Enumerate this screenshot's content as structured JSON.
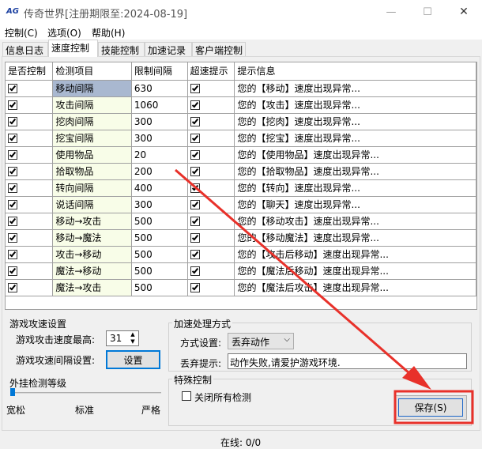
{
  "titlebar": {
    "logo": "AG",
    "title": "传奇世界[注册期限至:2024-08-19]"
  },
  "menubar": {
    "items": [
      "控制(C)",
      "选项(O)",
      "帮助(H)"
    ]
  },
  "tabs": [
    "信息日志",
    "速度控制",
    "技能控制",
    "加速记录",
    "客户端控制"
  ],
  "active_tab": 1,
  "grid": {
    "headers": [
      "是否控制",
      "检测项目",
      "限制间隔",
      "超速提示",
      "提示信息"
    ],
    "rows": [
      {
        "checked": true,
        "item": "移动间隔",
        "interval": "630",
        "warn": true,
        "msg": "您的【移动】速度出现异常..."
      },
      {
        "checked": true,
        "item": "攻击间隔",
        "interval": "1060",
        "warn": true,
        "msg": "您的【攻击】速度出现异常..."
      },
      {
        "checked": true,
        "item": "挖肉间隔",
        "interval": "300",
        "warn": true,
        "msg": "您的【挖肉】速度出现异常..."
      },
      {
        "checked": true,
        "item": "挖宝间隔",
        "interval": "300",
        "warn": true,
        "msg": "您的【挖宝】速度出现异常..."
      },
      {
        "checked": true,
        "item": "使用物品",
        "interval": "20",
        "warn": true,
        "msg": "您的【使用物品】速度出现异常..."
      },
      {
        "checked": true,
        "item": "拾取物品",
        "interval": "200",
        "warn": true,
        "msg": "您的【拾取物品】速度出现异常..."
      },
      {
        "checked": true,
        "item": "转向间隔",
        "interval": "400",
        "warn": true,
        "msg": "您的【转向】速度出现异常..."
      },
      {
        "checked": true,
        "item": "说话间隔",
        "interval": "300",
        "warn": true,
        "msg": "您的【聊天】速度出现异常..."
      },
      {
        "checked": true,
        "item": "移动→攻击",
        "interval": "500",
        "warn": true,
        "msg": "您的【移动攻击】速度出现异常..."
      },
      {
        "checked": true,
        "item": "移动→魔法",
        "interval": "500",
        "warn": true,
        "msg": "您的【移动魔法】速度出现异常..."
      },
      {
        "checked": true,
        "item": "攻击→移动",
        "interval": "500",
        "warn": true,
        "msg": "您的【攻击后移动】速度出现异常..."
      },
      {
        "checked": true,
        "item": "魔法→移动",
        "interval": "500",
        "warn": true,
        "msg": "您的【魔法后移动】速度出现异常..."
      },
      {
        "checked": true,
        "item": "魔法→攻击",
        "interval": "500",
        "warn": true,
        "msg": "您的【魔法后攻击】速度出现异常..."
      }
    ]
  },
  "attack_speed": {
    "title": "游戏攻速设置",
    "max_label": "游戏攻击速度最高:",
    "max_value": "31",
    "interval_label": "游戏攻速间隔设置:",
    "set_button": "设置"
  },
  "cheat_level": {
    "title": "外挂检测等级",
    "levels": [
      "宽松",
      "标准",
      "严格"
    ],
    "level": 0
  },
  "accel": {
    "title": "加速处理方式",
    "mode_label": "方式设置:",
    "mode_value": "丢弃动作",
    "drop_label": "丢弃提示:",
    "drop_value": "动作失败,请爱护游戏环境."
  },
  "special": {
    "title": "特殊控制",
    "close_all_label": "关闭所有检测",
    "close_all_checked": false
  },
  "save_button": "保存(S)",
  "status": {
    "online": "在线: 0/0"
  },
  "colors": {
    "annotation": "#e8312a",
    "selected_cell": "#a9b8d0",
    "item_cell": "#f8fde8",
    "focus_border": "#0078d7"
  }
}
